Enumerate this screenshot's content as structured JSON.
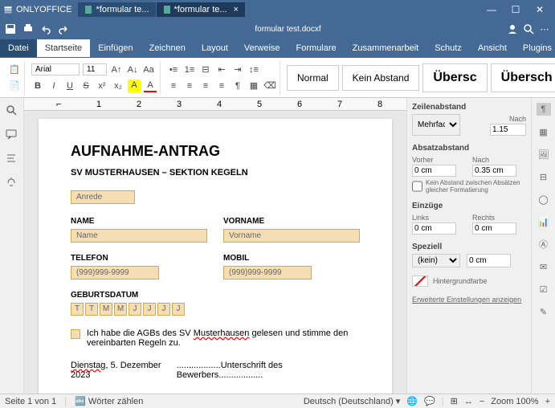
{
  "app": {
    "name": "ONLYOFFICE"
  },
  "tabs": [
    {
      "label": "*formular te...",
      "active": false
    },
    {
      "label": "*formular te...",
      "active": true
    }
  ],
  "window": {
    "doc_title": "formular test.docxf"
  },
  "menu": {
    "file": "Datei",
    "items": [
      "Startseite",
      "Einfügen",
      "Zeichnen",
      "Layout",
      "Verweise",
      "Formulare",
      "Zusammenarbeit",
      "Schutz",
      "Ansicht",
      "Plugins"
    ]
  },
  "ribbon": {
    "font_name": "Arial",
    "font_size": "11",
    "styles": {
      "normal": "Normal",
      "nospacing": "Kein Abstand",
      "heading1": "Übersc",
      "heading2": "Übersch"
    }
  },
  "doc": {
    "title": "AUFNAHME-ANTRAG",
    "subtitle": "SV MUSTERHAUSEN – SEKTION KEGELN",
    "anrede_label": "Anrede",
    "name_label": "NAME",
    "name_ph": "Name",
    "vorname_label": "VORNAME",
    "vorname_ph": "Vorname",
    "telefon_label": "TELEFON",
    "telefon_ph": "(999)999-9999",
    "mobil_label": "MOBIL",
    "mobil_ph": "(999)999-9999",
    "geburt_label": "GEBURTSDATUM",
    "date_chars": [
      "T",
      "T",
      "M",
      "M",
      "J",
      "J",
      "J",
      "J"
    ],
    "agb_text_1": "Ich habe die AGBs des SV ",
    "agb_text_2": "Musterhausen",
    "agb_text_3": " gelesen und stimme den vereinbarten Regeln zu.",
    "date_text_1": "Dienstag",
    "date_text_2": ", 5. Dezember 2023",
    "sig_text": "Unterschrift des Bewerbers"
  },
  "panel": {
    "line_spacing": {
      "title": "Zeilenabstand",
      "mode": "Mehrfach",
      "value": "1.15",
      "after": "Nach"
    },
    "para_spacing": {
      "title": "Absatzabstand",
      "before_lbl": "Vorher",
      "after_lbl": "Nach",
      "before": "0 cm",
      "after": "0.35 cm"
    },
    "no_spacing_cb": "Kein Abstand zwischen Absätzen gleicher Formatierung",
    "indent": {
      "title": "Einzüge",
      "left_lbl": "Links",
      "right_lbl": "Rechts",
      "left": "0 cm",
      "right": "0 cm"
    },
    "special": {
      "title": "Speziell",
      "mode": "(kein)",
      "value": "0 cm"
    },
    "bg_color": "Hintergrundfarbe",
    "advanced": "Erweiterte Einstellungen anzeigen"
  },
  "status": {
    "page": "Seite 1 von 1",
    "wordcount": "Wörter zählen",
    "lang": "Deutsch (Deutschland)",
    "zoom": "Zoom 100%"
  }
}
